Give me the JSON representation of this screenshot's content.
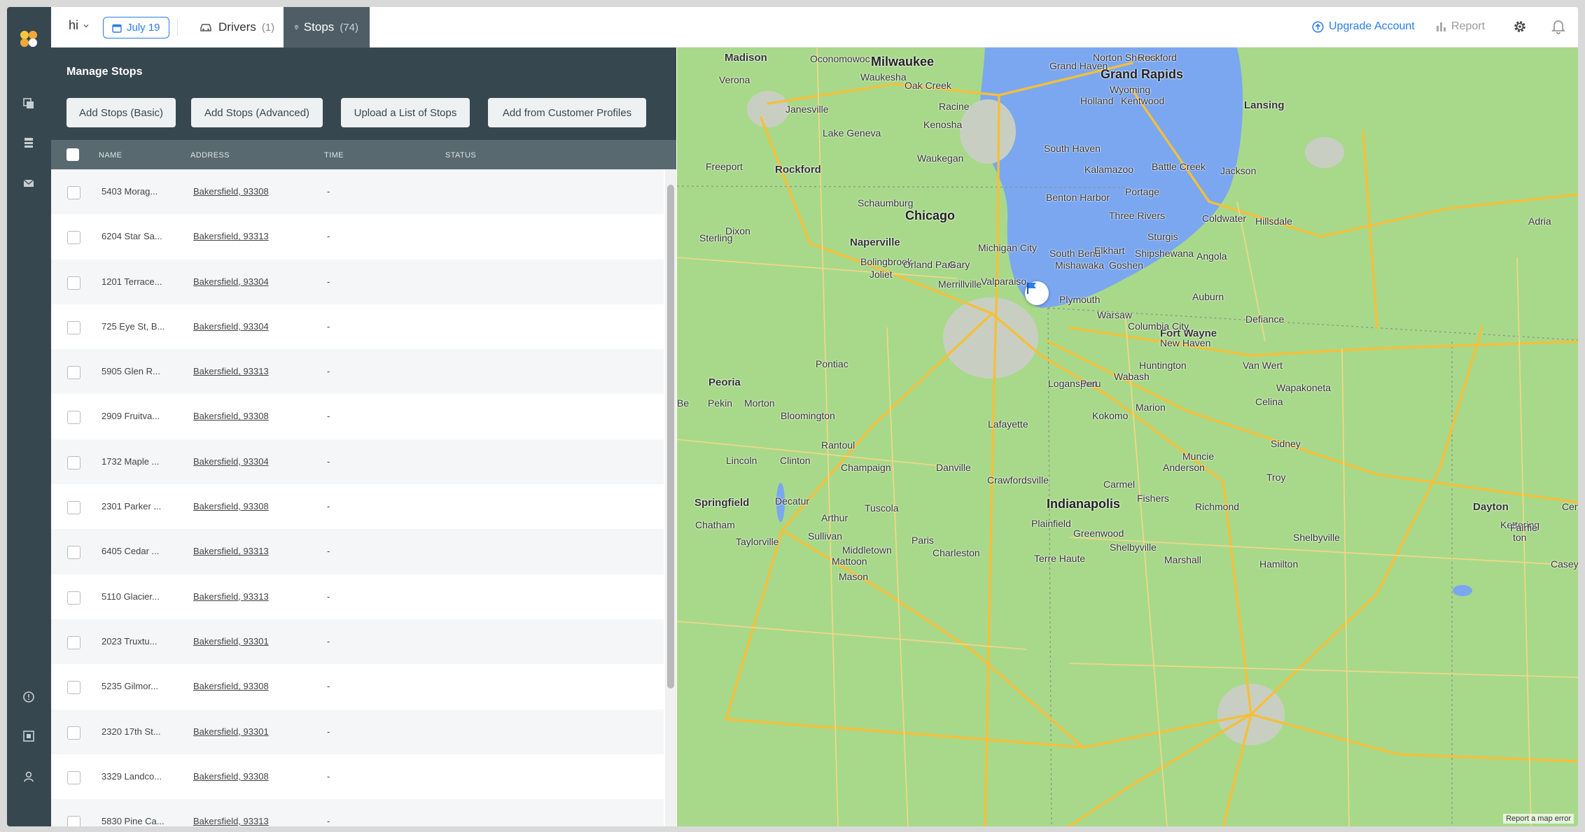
{
  "topbar": {
    "route_name": "hi",
    "date": "July 19",
    "tabs": [
      {
        "label": "Drivers",
        "count": "(1)"
      },
      {
        "label": "Stops",
        "count": "(74)"
      }
    ],
    "upgrade_label": "Upgrade Account",
    "report_label": "Report"
  },
  "panel": {
    "title": "Manage Stops",
    "buttons": [
      "Add Stops (Basic)",
      "Add Stops (Advanced)",
      "Upload a List of Stops",
      "Add from Customer Profiles"
    ],
    "columns": [
      "NAME",
      "ADDRESS",
      "TIME",
      "STATUS"
    ],
    "rows": [
      {
        "name": "5403 Morag...",
        "address": "Bakersfield, 93308",
        "time": "-"
      },
      {
        "name": "6204 Star Sa...",
        "address": "Bakersfield, 93313",
        "time": "-"
      },
      {
        "name": "1201 Terrace...",
        "address": "Bakersfield, 93304",
        "time": "-"
      },
      {
        "name": "725 Eye St, B...",
        "address": "Bakersfield, 93304",
        "time": "-"
      },
      {
        "name": "5905 Glen R...",
        "address": "Bakersfield, 93313",
        "time": "-"
      },
      {
        "name": "2909 Fruitva...",
        "address": "Bakersfield, 93308",
        "time": "-"
      },
      {
        "name": "1732 Maple ...",
        "address": "Bakersfield, 93304",
        "time": "-"
      },
      {
        "name": "2301 Parker ...",
        "address": "Bakersfield, 93308",
        "time": "-"
      },
      {
        "name": "6405 Cedar ...",
        "address": "Bakersfield, 93313",
        "time": "-"
      },
      {
        "name": "5110 Glacier...",
        "address": "Bakersfield, 93313",
        "time": "-"
      },
      {
        "name": "2023 Truxtu...",
        "address": "Bakersfield, 93301",
        "time": "-"
      },
      {
        "name": "5235 Gilmor...",
        "address": "Bakersfield, 93308",
        "time": "-"
      },
      {
        "name": "2320 17th St...",
        "address": "Bakersfield, 93301",
        "time": "-"
      },
      {
        "name": "3329 Landco...",
        "address": "Bakersfield, 93308",
        "time": "-"
      },
      {
        "name": "5830 Pine Ca...",
        "address": "Bakersfield, 93313",
        "time": "-"
      }
    ]
  },
  "map": {
    "labels": [
      {
        "text": "Madison",
        "cls": "mid"
      },
      {
        "text": "Milwaukee",
        "cls": "big"
      },
      {
        "text": "Grand Rapids",
        "cls": "big"
      },
      {
        "text": "Lansing",
        "cls": "mid"
      },
      {
        "text": "Rockford",
        "cls": "mid"
      },
      {
        "text": "Chicago",
        "cls": "big"
      },
      {
        "text": "Naperville",
        "cls": "mid"
      },
      {
        "text": "Fort Wayne",
        "cls": "mid"
      },
      {
        "text": "Peoria",
        "cls": "mid"
      },
      {
        "text": "Springfield",
        "cls": "mid"
      },
      {
        "text": "Indianapolis",
        "cls": "big"
      },
      {
        "text": "Dayton",
        "cls": "mid"
      },
      {
        "text": "Oconomowoc",
        "cls": ""
      },
      {
        "text": "Waukesha",
        "cls": ""
      },
      {
        "text": "Oak Creek",
        "cls": ""
      },
      {
        "text": "Racine",
        "cls": ""
      },
      {
        "text": "Kenosha",
        "cls": ""
      },
      {
        "text": "Janesville",
        "cls": ""
      },
      {
        "text": "Lake Geneva",
        "cls": ""
      },
      {
        "text": "Waukegan",
        "cls": ""
      },
      {
        "text": "Freeport",
        "cls": ""
      },
      {
        "text": "Verona",
        "cls": ""
      },
      {
        "text": "Schaumburg",
        "cls": ""
      },
      {
        "text": "Dixon",
        "cls": ""
      },
      {
        "text": "Sterling",
        "cls": ""
      },
      {
        "text": "Bolingbrook",
        "cls": ""
      },
      {
        "text": "Orland Park",
        "cls": ""
      },
      {
        "text": "Joliet",
        "cls": ""
      },
      {
        "text": "Gary",
        "cls": ""
      },
      {
        "text": "Merrillville",
        "cls": ""
      },
      {
        "text": "Valparaiso",
        "cls": ""
      },
      {
        "text": "Michigan City",
        "cls": ""
      },
      {
        "text": "South Bend",
        "cls": ""
      },
      {
        "text": "Elkhart",
        "cls": ""
      },
      {
        "text": "Mishawaka",
        "cls": ""
      },
      {
        "text": "Goshen",
        "cls": ""
      },
      {
        "text": "Shipshewana",
        "cls": ""
      },
      {
        "text": "Angola",
        "cls": ""
      },
      {
        "text": "Norton Shores",
        "cls": ""
      },
      {
        "text": "Grand Haven",
        "cls": ""
      },
      {
        "text": "Rockford",
        "cls": ""
      },
      {
        "text": "Wyoming",
        "cls": ""
      },
      {
        "text": "Holland",
        "cls": ""
      },
      {
        "text": "Kentwood",
        "cls": ""
      },
      {
        "text": "South Haven",
        "cls": ""
      },
      {
        "text": "Kalamazoo",
        "cls": ""
      },
      {
        "text": "Battle Creek",
        "cls": ""
      },
      {
        "text": "Jackson",
        "cls": ""
      },
      {
        "text": "Benton Harbor",
        "cls": ""
      },
      {
        "text": "Portage",
        "cls": ""
      },
      {
        "text": "Three Rivers",
        "cls": ""
      },
      {
        "text": "Coldwater",
        "cls": ""
      },
      {
        "text": "Hillsdale",
        "cls": ""
      },
      {
        "text": "Adria",
        "cls": ""
      },
      {
        "text": "Sturgis",
        "cls": ""
      },
      {
        "text": "Plymouth",
        "cls": ""
      },
      {
        "text": "Warsaw",
        "cls": ""
      },
      {
        "text": "Auburn",
        "cls": ""
      },
      {
        "text": "Columbia City",
        "cls": ""
      },
      {
        "text": "New Haven",
        "cls": ""
      },
      {
        "text": "Defiance",
        "cls": ""
      },
      {
        "text": "Huntington",
        "cls": ""
      },
      {
        "text": "Van Wert",
        "cls": ""
      },
      {
        "text": "Wabash",
        "cls": ""
      },
      {
        "text": "Logansport",
        "cls": ""
      },
      {
        "text": "Peru",
        "cls": ""
      },
      {
        "text": "Marion",
        "cls": ""
      },
      {
        "text": "Celina",
        "cls": ""
      },
      {
        "text": "Wapakoneta",
        "cls": ""
      },
      {
        "text": "Kokomo",
        "cls": ""
      },
      {
        "text": "Sidney",
        "cls": ""
      },
      {
        "text": "Pontiac",
        "cls": ""
      },
      {
        "text": "Pekin",
        "cls": ""
      },
      {
        "text": "Morton",
        "cls": ""
      },
      {
        "text": "Bloomington",
        "cls": ""
      },
      {
        "text": "Lafayette",
        "cls": ""
      },
      {
        "text": "Rantoul",
        "cls": ""
      },
      {
        "text": "Muncie",
        "cls": ""
      },
      {
        "text": "Anderson",
        "cls": ""
      },
      {
        "text": "Troy",
        "cls": ""
      },
      {
        "text": "Lincoln",
        "cls": ""
      },
      {
        "text": "Clinton",
        "cls": ""
      },
      {
        "text": "Champaign",
        "cls": ""
      },
      {
        "text": "Danville",
        "cls": ""
      },
      {
        "text": "Crawfordsville",
        "cls": ""
      },
      {
        "text": "Carmel",
        "cls": ""
      },
      {
        "text": "Fishers",
        "cls": ""
      },
      {
        "text": "Richmond",
        "cls": ""
      },
      {
        "text": "Decatur",
        "cls": ""
      },
      {
        "text": "Tuscola",
        "cls": ""
      },
      {
        "text": "Chatham",
        "cls": ""
      },
      {
        "text": "Arthur",
        "cls": ""
      },
      {
        "text": "Plainfield",
        "cls": ""
      },
      {
        "text": "Greenwood",
        "cls": ""
      },
      {
        "text": "Kettering",
        "cls": ""
      },
      {
        "text": "Taylorville",
        "cls": ""
      },
      {
        "text": "Sullivan",
        "cls": ""
      },
      {
        "text": "Paris",
        "cls": ""
      },
      {
        "text": "Shelbyville",
        "cls": ""
      },
      {
        "text": "Middletown",
        "cls": ""
      },
      {
        "text": "Mattoon",
        "cls": ""
      },
      {
        "text": "Charleston",
        "cls": ""
      },
      {
        "text": "Terre Haute",
        "cls": ""
      },
      {
        "text": "Shelbyville",
        "cls": ""
      },
      {
        "text": "Marshall",
        "cls": ""
      },
      {
        "text": "Hamilton",
        "cls": ""
      },
      {
        "text": "Mason",
        "cls": ""
      },
      {
        "text": "Casey",
        "cls": ""
      },
      {
        "text": "Fairfie",
        "cls": ""
      },
      {
        "text": "ton",
        "cls": ""
      },
      {
        "text": "Be",
        "cls": ""
      },
      {
        "text": "Cente",
        "cls": ""
      }
    ],
    "footer": "Report a map error"
  },
  "colors": {
    "rail": "#37474f",
    "accent": "#2b7de9",
    "active_tab": "#4f5e66",
    "lake": "#7aa7f0",
    "land": "#a8d98a"
  },
  "icons": [
    "logo-icon",
    "copy-icon",
    "stack-icon",
    "mail-icon",
    "info-icon",
    "grid-icon",
    "user-icon",
    "calendar-icon",
    "car-icon",
    "pin-icon",
    "upgrade-icon",
    "bar-chart-icon",
    "gear-icon",
    "bell-icon",
    "flag-icon"
  ]
}
